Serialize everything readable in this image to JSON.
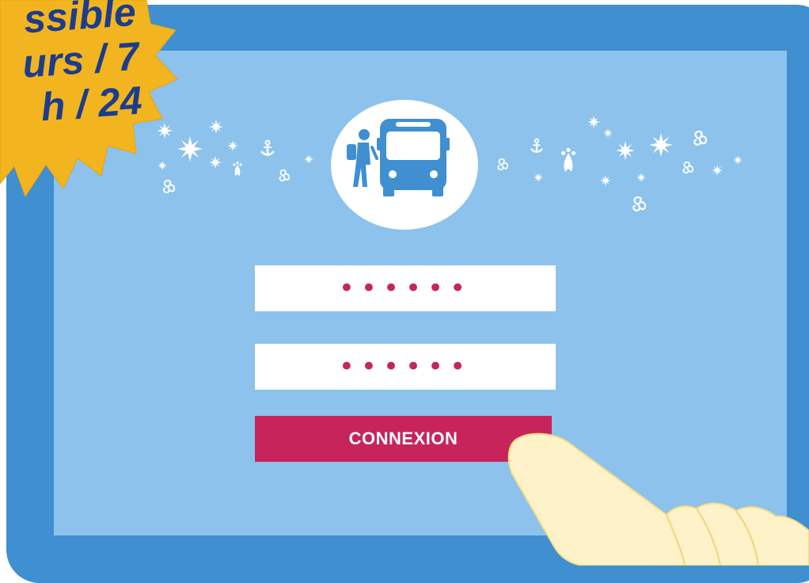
{
  "badge": {
    "lines": [
      "ssible",
      "urs / 7",
      "h / 24"
    ],
    "color": "#f2b51f",
    "text_color": "#1d3d8c"
  },
  "login": {
    "field_1_value": "••••••",
    "field_2_value": "••••••",
    "button_label": "CONNEXION"
  },
  "colors": {
    "tablet_frame": "#3f8fd1",
    "screen": "#8cc2ec",
    "accent": "#c8245c",
    "logo_icon": "#3f8fd1"
  },
  "icons": {
    "logo": "bus-and-hiker-icon",
    "decorations": [
      "star-icon",
      "anchor-icon",
      "ermine-icon",
      "triskel-icon"
    ]
  }
}
